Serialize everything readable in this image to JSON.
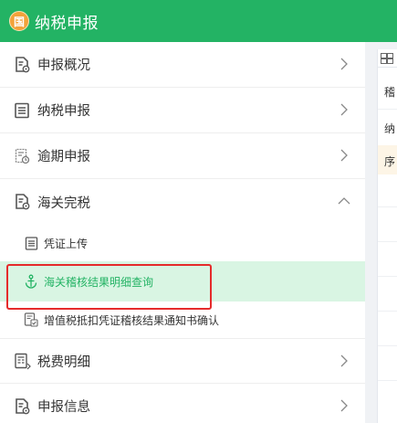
{
  "header": {
    "logo_char": "国",
    "title": "纳税申报"
  },
  "nav": {
    "item1": {
      "label": "申报概况"
    },
    "item2": {
      "label": "纳税申报"
    },
    "item3": {
      "label": "逾期申报"
    },
    "item4": {
      "label": "海关完税",
      "expanded": true,
      "children": [
        {
          "label": "凭证上传"
        },
        {
          "label": "海关稽核结果明细查询",
          "active": true
        },
        {
          "label": "增值税抵扣凭证稽核结果通知书确认"
        }
      ]
    },
    "item5": {
      "label": "税费明细"
    },
    "item6": {
      "label": "申报信息"
    }
  },
  "right_panel": {
    "text_top": "稽",
    "text_row1": "纳",
    "text_row2": "序"
  },
  "colors": {
    "brand_green": "#23b364",
    "active_bg": "#d9f5e3",
    "highlight_red": "#e52b2b"
  }
}
